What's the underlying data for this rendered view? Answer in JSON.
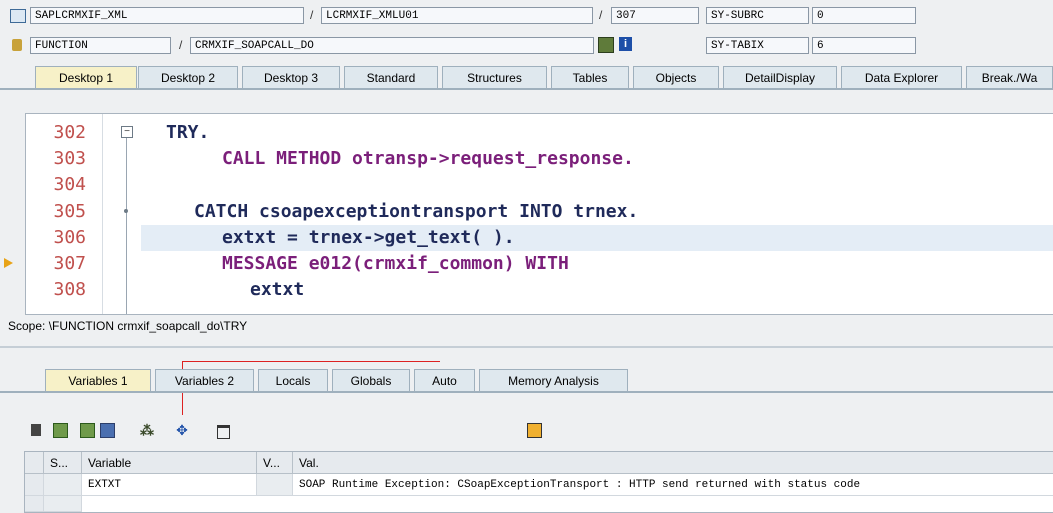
{
  "header": {
    "program_icon": "program-icon",
    "program": "SAPLCRMXIF_XML",
    "include": "LCRMXIF_XMLU01",
    "line": "307",
    "subrc_label": "SY-SUBRC",
    "subrc_value": "0",
    "function_icon": "function-icon",
    "function_label": "FUNCTION",
    "function_name": "CRMXIF_SOAPCALL_DO",
    "tabix_label": "SY-TABIX",
    "tabix_value": "6",
    "slash": "/"
  },
  "desktop_tabs": [
    {
      "label": "Desktop 1"
    },
    {
      "label": "Desktop 2"
    },
    {
      "label": "Desktop 3"
    },
    {
      "label": "Standard"
    },
    {
      "label": "Structures"
    },
    {
      "label": "Tables"
    },
    {
      "label": "Objects"
    },
    {
      "label": "DetailDisplay"
    },
    {
      "label": "Data Explorer"
    },
    {
      "label": "Break./Wa"
    }
  ],
  "code": {
    "lines": [
      {
        "num": "302",
        "text": "TRY."
      },
      {
        "num": "303",
        "text": "CALL METHOD otransp->request_response."
      },
      {
        "num": "304",
        "text": ""
      },
      {
        "num": "305",
        "text": "CATCH csoapexceptiontransport INTO trnex."
      },
      {
        "num": "306",
        "text": "extxt = trnex->get_text( )."
      },
      {
        "num": "307",
        "text": "MESSAGE e012(crmxif_common) WITH"
      },
      {
        "num": "308",
        "text": "extxt"
      }
    ]
  },
  "scope": "Scope: \\FUNCTION crmxif_soapcall_do\\TRY",
  "var_tabs": [
    {
      "label": "Variables 1"
    },
    {
      "label": "Variables 2"
    },
    {
      "label": "Locals"
    },
    {
      "label": "Globals"
    },
    {
      "label": "Auto"
    },
    {
      "label": "Memory Analysis"
    }
  ],
  "toolbar_icons": [
    "delete-icon",
    "layout-icon",
    "layout-save-icon",
    "layout-select-icon",
    "hierarchy-icon",
    "move-icon",
    "tab-icon",
    "save-icon"
  ],
  "grid": {
    "headers": [
      "S...",
      "Variable",
      "V...",
      "Val."
    ],
    "rows": [
      {
        "variable": "EXTXT",
        "value": "SOAP Runtime Exception: CSoapExceptionTransport : HTTP send returned with status code"
      }
    ]
  },
  "colors": {
    "active_tab": "#f7f1c8",
    "keyword": "#7b1f7a",
    "line_number": "#c0504d",
    "current_line": "#e4edf6"
  }
}
